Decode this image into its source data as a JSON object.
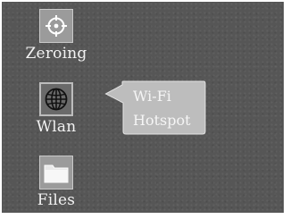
{
  "apps": [
    {
      "label": "Zeroing",
      "icon": "crosshair-icon"
    },
    {
      "label": "Wlan",
      "icon": "globe-icon"
    },
    {
      "label": "Files",
      "icon": "folder-icon"
    }
  ],
  "popup": {
    "items": [
      "Wi-Fi",
      "Hotspot"
    ]
  },
  "colors": {
    "background": "#565656",
    "popup_fill": "#bdbdbd",
    "text": "#f2f2f2"
  }
}
